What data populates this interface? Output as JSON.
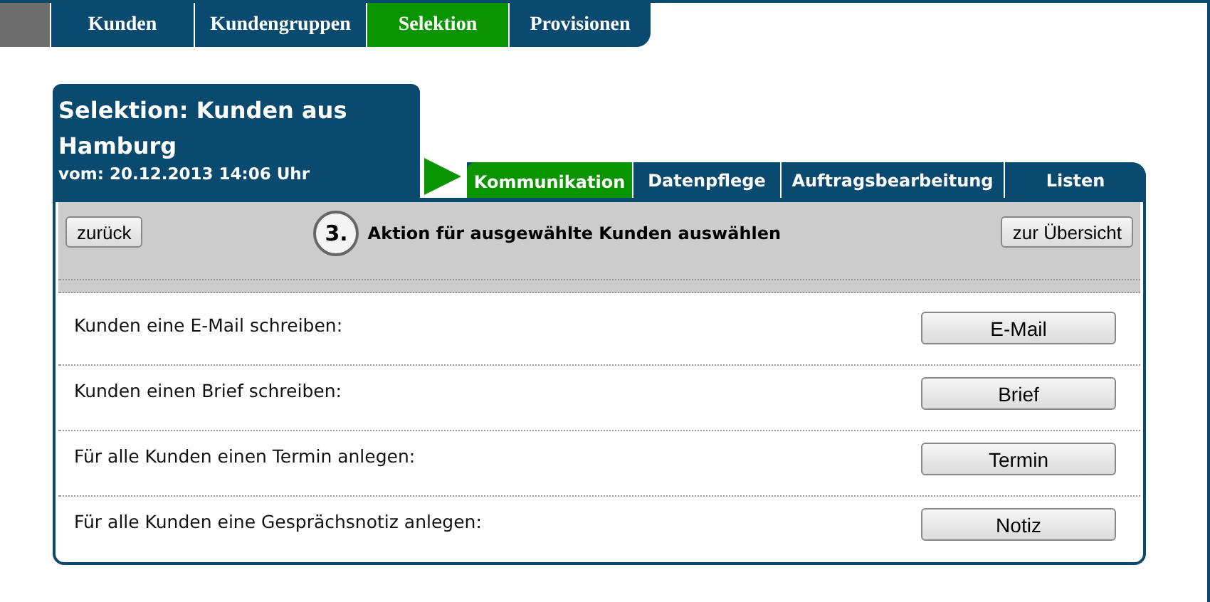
{
  "nav_tabs": [
    {
      "label": "Kunden",
      "selected": false
    },
    {
      "label": "Kundengruppen",
      "selected": false
    },
    {
      "label": "Selektion",
      "selected": true
    },
    {
      "label": "Provisionen",
      "selected": false
    }
  ],
  "selection": {
    "title": "Selektion: Kunden aus Hamburg",
    "date": "vom: 20.12.2013 14:06 Uhr"
  },
  "sub_tabs": [
    {
      "label": "Kommunikation",
      "selected": true
    },
    {
      "label": "Datenpflege",
      "selected": false
    },
    {
      "label": "Auftragsbearbeitung",
      "selected": false
    },
    {
      "label": "Listen",
      "selected": false
    }
  ],
  "toolbar": {
    "back_button": "zurück",
    "step": "3.",
    "heading": "Aktion für ausgewählte Kunden auswählen",
    "overview_button": "zur Übersicht"
  },
  "actions": [
    {
      "label": "Kunden eine E-Mail schreiben:",
      "button": "E-Mail"
    },
    {
      "label": "Kunden einen Brief schreiben:",
      "button": "Brief"
    },
    {
      "label": "Für alle Kunden einen Termin anlegen:",
      "button": "Termin"
    },
    {
      "label": "Für alle Kunden eine Gesprächsnotiz anlegen:",
      "button": "Notiz"
    }
  ]
}
